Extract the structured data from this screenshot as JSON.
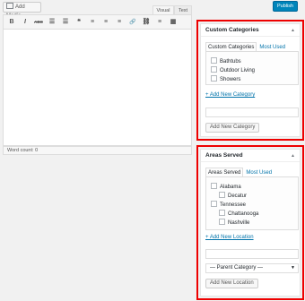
{
  "editor": {
    "add_media_label": "Add Media",
    "tabs": {
      "visual": "Visual",
      "text": "Text"
    },
    "toolbar": [
      "B",
      "I",
      "ABC",
      "☰",
      "☰",
      "❝",
      "≡",
      "≡",
      "≡",
      "🔗",
      "⛓",
      "≡",
      "▦"
    ],
    "word_count": "Word count: 0"
  },
  "publish_label": "Publish",
  "custom_categories": {
    "title": "Custom Categories",
    "tabs": {
      "active": "Custom Categories",
      "other": "Most Used"
    },
    "items": [
      "Bathtubs",
      "Outdoor Living",
      "Showers"
    ],
    "add_new_link": "+ Add New Category",
    "add_button": "Add New Category"
  },
  "areas_served": {
    "title": "Areas Served",
    "tabs": {
      "active": "Areas Served",
      "other": "Most Used"
    },
    "items": [
      {
        "label": "Alabama"
      },
      {
        "label": "Decatur"
      },
      {
        "label": "Tennessee"
      },
      {
        "label": "Chattanooga"
      },
      {
        "label": "Nashville"
      }
    ],
    "add_new_link": "+ Add New Location",
    "parent_select": "— Parent Category —",
    "add_button": "Add New Location"
  }
}
